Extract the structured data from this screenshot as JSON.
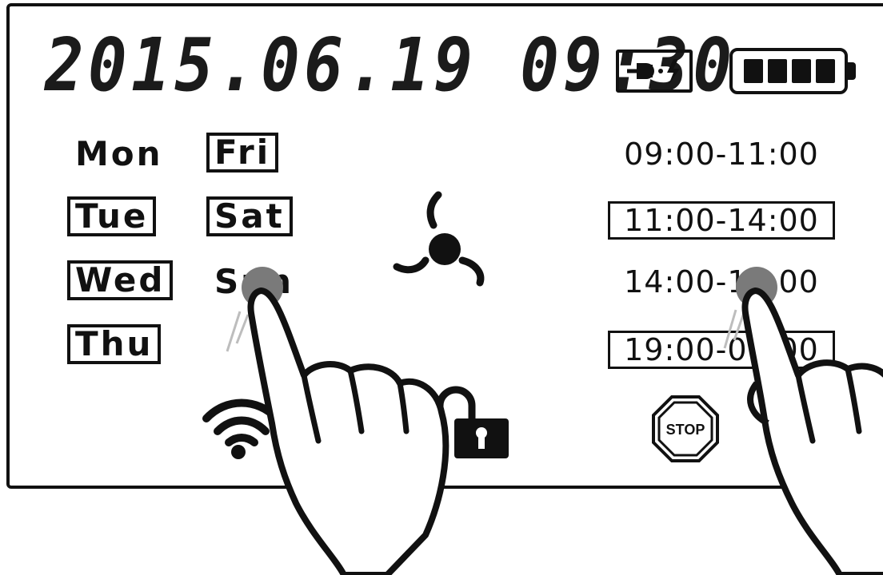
{
  "datetime": "2015.06.19 09:30",
  "status_icons": [
    "plug-charge-icon",
    "battery-full-icon"
  ],
  "days": [
    {
      "label": "Mon",
      "selected": false
    },
    {
      "label": "Tue",
      "selected": true
    },
    {
      "label": "Wed",
      "selected": true
    },
    {
      "label": "Thu",
      "selected": true
    },
    {
      "label": "Fri",
      "selected": true
    },
    {
      "label": "Sat",
      "selected": true
    },
    {
      "label": "Sun",
      "selected": false
    }
  ],
  "time_slots": [
    {
      "label": "09:00-11:00",
      "selected": false
    },
    {
      "label": "11:00-14:00",
      "selected": true
    },
    {
      "label": "14:00-19:00",
      "selected": false
    },
    {
      "label": "19:00-09:00",
      "selected": true
    }
  ],
  "center_icon": "fan-icon",
  "bottom_icons": [
    "wifi-icon",
    "lock-icon",
    "stop-icon"
  ],
  "stop_label": "STOP",
  "colors": {
    "ink": "#111111",
    "touch_dot": "#7a7a7a",
    "background": "#ffffff"
  }
}
